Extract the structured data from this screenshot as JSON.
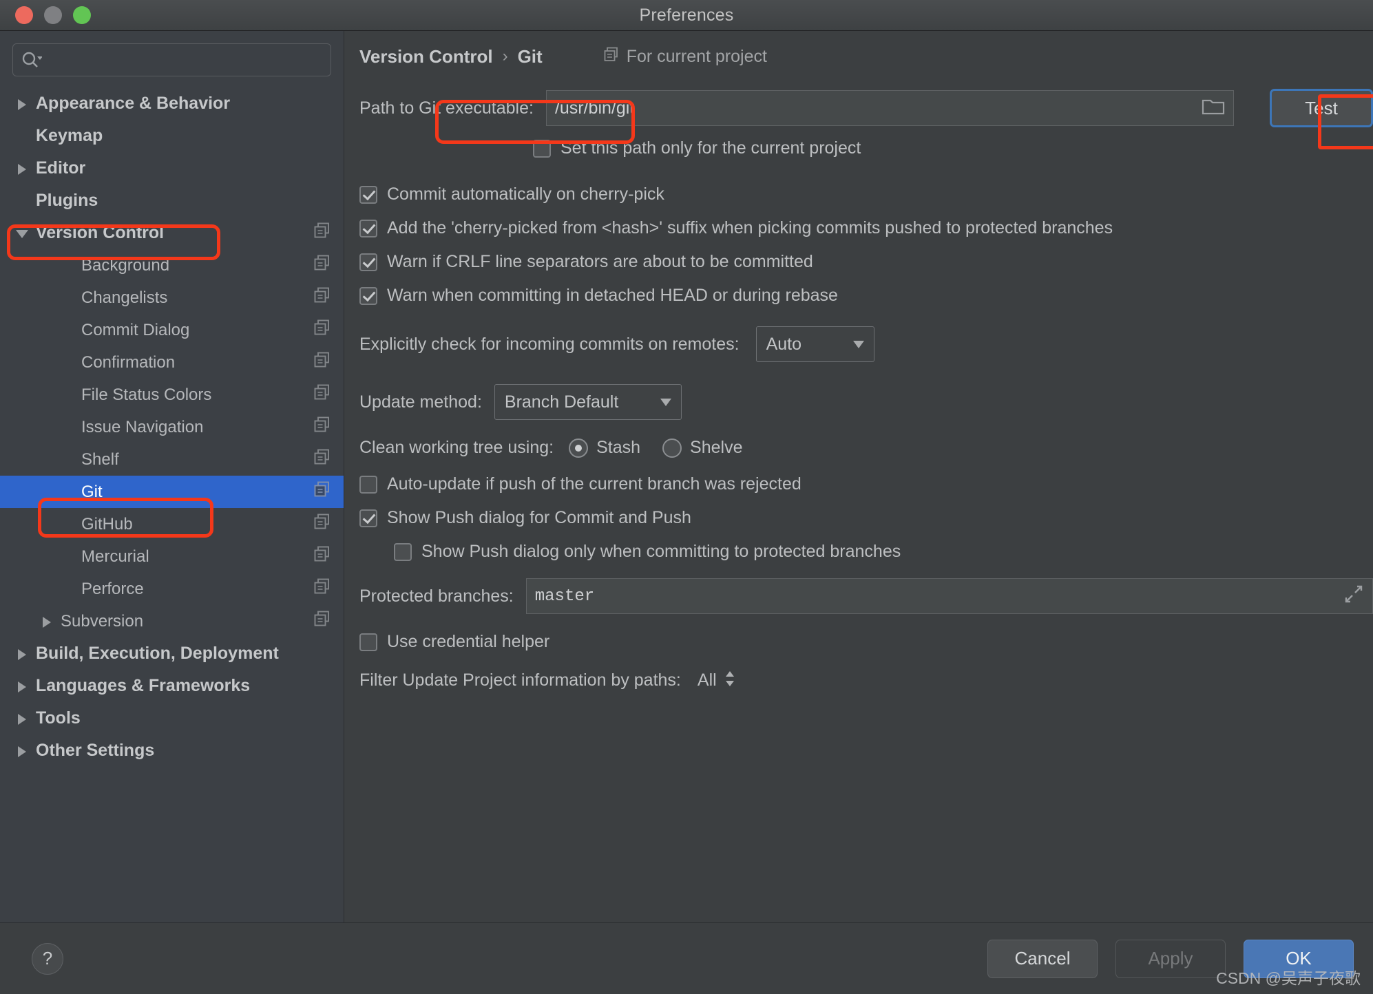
{
  "window": {
    "title": "Preferences",
    "traffic_lights": [
      "close-red",
      "minimize-gray",
      "zoom-green"
    ]
  },
  "search": {
    "placeholder": "",
    "value": "",
    "icon": "search-icon"
  },
  "sidebar": {
    "items": [
      {
        "label": "Appearance & Behavior",
        "level": 0,
        "arrow": "right",
        "bold": true,
        "copy": false,
        "selected": false
      },
      {
        "label": "Keymap",
        "level": 0,
        "arrow": "none",
        "bold": true,
        "copy": false,
        "selected": false
      },
      {
        "label": "Editor",
        "level": 0,
        "arrow": "right",
        "bold": true,
        "copy": false,
        "selected": false
      },
      {
        "label": "Plugins",
        "level": 0,
        "arrow": "none",
        "bold": true,
        "copy": false,
        "selected": false
      },
      {
        "label": "Version Control",
        "level": 0,
        "arrow": "down",
        "bold": true,
        "copy": true,
        "selected": false
      },
      {
        "label": "Background",
        "level": 2,
        "arrow": "none",
        "bold": false,
        "copy": true,
        "selected": false
      },
      {
        "label": "Changelists",
        "level": 2,
        "arrow": "none",
        "bold": false,
        "copy": true,
        "selected": false
      },
      {
        "label": "Commit Dialog",
        "level": 2,
        "arrow": "none",
        "bold": false,
        "copy": true,
        "selected": false
      },
      {
        "label": "Confirmation",
        "level": 2,
        "arrow": "none",
        "bold": false,
        "copy": true,
        "selected": false
      },
      {
        "label": "File Status Colors",
        "level": 2,
        "arrow": "none",
        "bold": false,
        "copy": true,
        "selected": false
      },
      {
        "label": "Issue Navigation",
        "level": 2,
        "arrow": "none",
        "bold": false,
        "copy": true,
        "selected": false
      },
      {
        "label": "Shelf",
        "level": 2,
        "arrow": "none",
        "bold": false,
        "copy": true,
        "selected": false
      },
      {
        "label": "Git",
        "level": 2,
        "arrow": "none",
        "bold": false,
        "copy": true,
        "selected": true
      },
      {
        "label": "GitHub",
        "level": 2,
        "arrow": "none",
        "bold": false,
        "copy": true,
        "selected": false
      },
      {
        "label": "Mercurial",
        "level": 2,
        "arrow": "none",
        "bold": false,
        "copy": true,
        "selected": false
      },
      {
        "label": "Perforce",
        "level": 2,
        "arrow": "none",
        "bold": false,
        "copy": true,
        "selected": false
      },
      {
        "label": "Subversion",
        "level": 1,
        "arrow": "right",
        "bold": false,
        "copy": true,
        "selected": false
      },
      {
        "label": "Build, Execution, Deployment",
        "level": 0,
        "arrow": "right",
        "bold": true,
        "copy": false,
        "selected": false
      },
      {
        "label": "Languages & Frameworks",
        "level": 0,
        "arrow": "right",
        "bold": true,
        "copy": false,
        "selected": false
      },
      {
        "label": "Tools",
        "level": 0,
        "arrow": "right",
        "bold": true,
        "copy": false,
        "selected": false
      },
      {
        "label": "Other Settings",
        "level": 0,
        "arrow": "right",
        "bold": true,
        "copy": false,
        "selected": false
      }
    ]
  },
  "breadcrumb": {
    "root": "Version Control",
    "separator": "›",
    "current": "Git",
    "scope": "For current project",
    "scope_icon": "copy-icon"
  },
  "git": {
    "path_label": "Path to Git executable:",
    "path_value": "/usr/bin/git",
    "browse_icon": "folder-icon",
    "test_button": "Test",
    "set_path_only_label": "Set this path only for the current project",
    "set_path_only_checked": false,
    "checkboxes": [
      {
        "label": "Commit automatically on cherry-pick",
        "checked": true,
        "indent": 0
      },
      {
        "label": "Add the 'cherry-picked from <hash>' suffix when picking commits pushed to protected branches",
        "checked": true,
        "indent": 0
      },
      {
        "label": "Warn if CRLF line separators are about to be committed",
        "checked": true,
        "indent": 0
      },
      {
        "label": "Warn when committing in detached HEAD or during rebase",
        "checked": true,
        "indent": 0
      }
    ],
    "incoming_label": "Explicitly check for incoming commits on remotes:",
    "incoming_value": "Auto",
    "update_method_label": "Update method:",
    "update_method_value": "Branch Default",
    "clean_tree_label": "Clean working tree using:",
    "clean_tree_options": [
      {
        "label": "Stash",
        "selected": true
      },
      {
        "label": "Shelve",
        "selected": false
      }
    ],
    "auto_update_label": "Auto-update if push of the current branch was rejected",
    "auto_update_checked": false,
    "show_push_label": "Show Push dialog for Commit and Push",
    "show_push_checked": true,
    "show_push_protected_label": "Show Push dialog only when committing to protected branches",
    "show_push_protected_checked": false,
    "protected_branches_label": "Protected branches:",
    "protected_branches_value": "master",
    "expand_icon": "expand-icon",
    "credential_helper_label": "Use credential helper",
    "credential_helper_checked": false,
    "filter_label": "Filter Update Project information by paths:",
    "filter_value": "All"
  },
  "footer": {
    "help": "?",
    "cancel": "Cancel",
    "apply": "Apply",
    "ok": "OK"
  },
  "watermark": "CSDN @吴声子夜歌",
  "colors": {
    "accent_selection": "#2f65cb",
    "annotation_red": "#f4381a",
    "primary_button": "#4a77b5",
    "focus_ring": "#3d76b8"
  }
}
